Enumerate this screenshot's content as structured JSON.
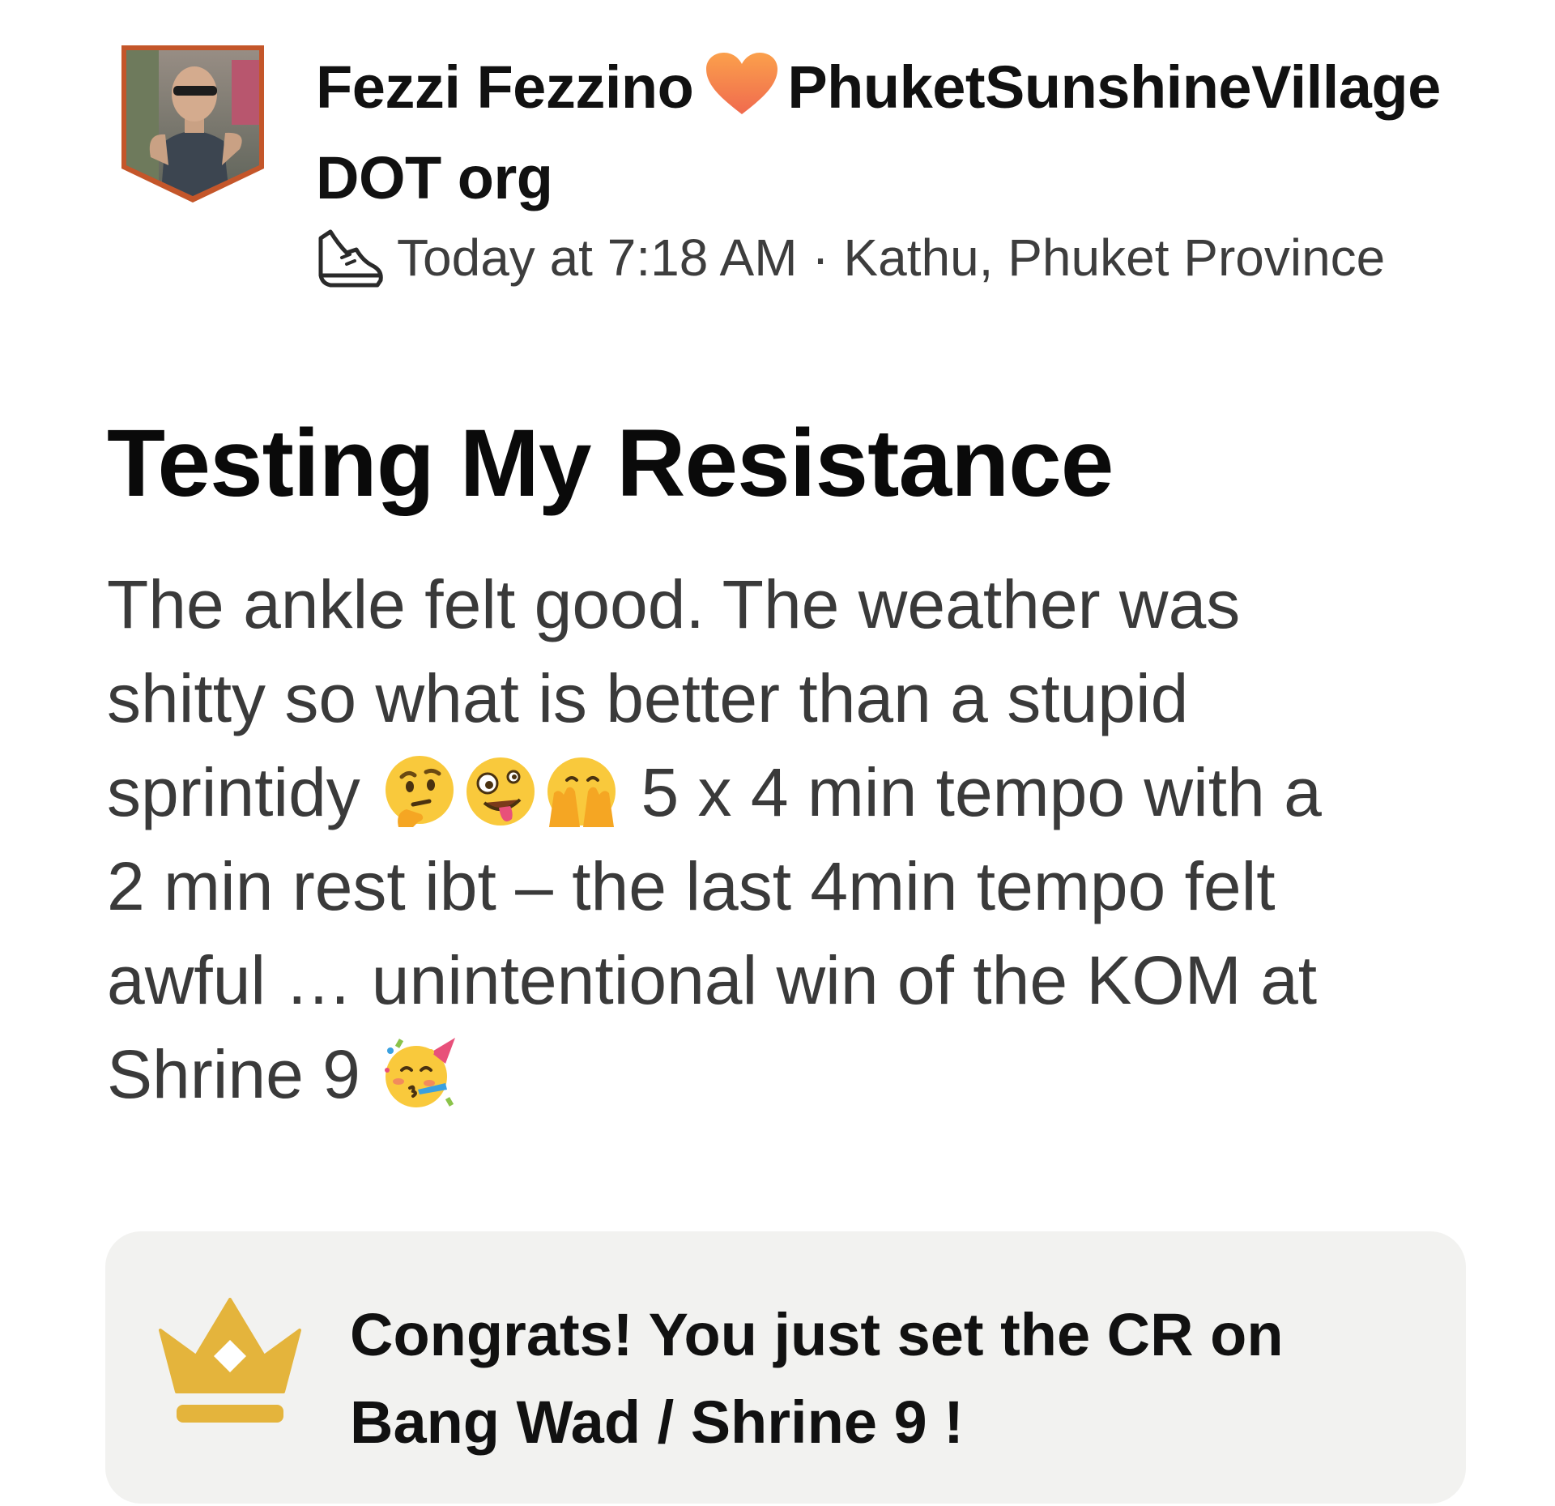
{
  "header": {
    "athlete_name_part1": "Fezzi Fezzino",
    "athlete_name_part2": "PhuketSunshineVillage DOT org",
    "heart_icon": "orange-heart-icon",
    "activity_type_icon": "running-shoe-icon",
    "timestamp": "Today at 7:18 AM",
    "separator": " · ",
    "location": "Kathu, Phuket Province"
  },
  "activity": {
    "title": "Testing My Resistance",
    "description": {
      "line1": "The ankle felt good. The weather was",
      "line2": "shitty so what is better than a stupid",
      "line3_prefix": "sprintidy",
      "line3_suffix": "5 x 4 min tempo with a",
      "line4": "2 min rest ibt – the last 4min tempo felt",
      "line5": "awful … unintentional win of the KOM at",
      "line6_prefix": "Shrine 9"
    },
    "emojis": [
      "thinking-face-icon",
      "zany-face-icon",
      "face-with-hand-over-mouth-icon",
      "partying-face-icon"
    ]
  },
  "achievement": {
    "icon": "crown-icon",
    "text_line1": "Congrats! You just set the CR on",
    "text_line2": "Bang Wad / Shrine 9 !"
  },
  "colors": {
    "crown": "#E4B43C",
    "avatar_border": "#C4562A",
    "card_background": "#F2F2F0",
    "heart": "#F47A3A"
  }
}
